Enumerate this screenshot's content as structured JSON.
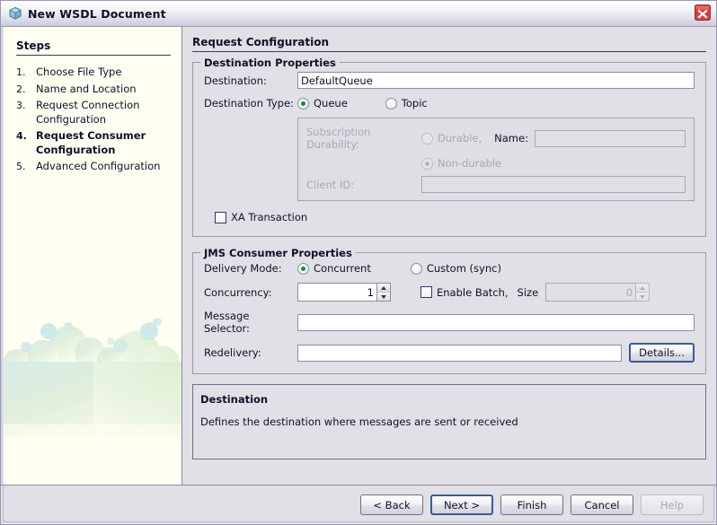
{
  "window": {
    "title": "New WSDL Document",
    "icon": "cube-icon",
    "close_icon": "close-icon"
  },
  "sidebar": {
    "heading": "Steps",
    "steps": [
      {
        "num": "1.",
        "label": "Choose File Type",
        "current": false
      },
      {
        "num": "2.",
        "label": "Name and Location",
        "current": false
      },
      {
        "num": "3.",
        "label": "Request Connection Configuration",
        "current": false
      },
      {
        "num": "4.",
        "label": "Request Consumer Configuration",
        "current": true
      },
      {
        "num": "5.",
        "label": "Advanced Configuration",
        "current": false
      }
    ]
  },
  "main": {
    "heading": "Request Configuration",
    "destination_group": {
      "legend": "Destination Properties",
      "destination_label": "Destination:",
      "destination_value": "DefaultQueue",
      "destination_placeholder": "",
      "destination_type_label": "Destination Type:",
      "queue_label": "Queue",
      "topic_label": "Topic",
      "type_selected": "Queue",
      "subscription": {
        "durability_label": "Subscription Durability:",
        "durable_label": "Durable,",
        "nondurable_label": "Non-durable",
        "durability_selected": "Non-durable",
        "name_label": "Name:",
        "name_value": "",
        "client_id_label": "Client ID:",
        "client_id_value": "",
        "enabled": false
      },
      "xa_transaction_label": "XA Transaction",
      "xa_transaction_checked": false
    },
    "consumer_group": {
      "legend": "JMS Consumer Properties",
      "delivery_mode_label": "Delivery Mode:",
      "concurrent_label": "Concurrent",
      "custom_sync_label": "Custom (sync)",
      "delivery_mode_selected": "Concurrent",
      "concurrency_label": "Concurrency:",
      "concurrency_value": "1",
      "enable_batch_label": "Enable Batch,",
      "enable_batch_checked": false,
      "size_label": "Size",
      "size_value": "0",
      "size_enabled": false,
      "message_selector_label": "Message Selector:",
      "message_selector_value": "",
      "redelivery_label": "Redelivery:",
      "redelivery_value": "",
      "details_label": "Details..."
    },
    "description": {
      "title": "Destination",
      "text": "Defines the destination where messages are sent or received"
    }
  },
  "footer": {
    "back_label": "< Back",
    "next_label": "Next >",
    "finish_label": "Finish",
    "cancel_label": "Cancel",
    "help_label": "Help",
    "help_disabled": true,
    "default_button": "Next >"
  },
  "colors": {
    "accent_radio": "#1f8a2f",
    "focus_border": "#3a5a9a",
    "panel_bg": "#e0e0e6",
    "steps_bg": "#fffff2",
    "close_red": "#d1403f"
  }
}
